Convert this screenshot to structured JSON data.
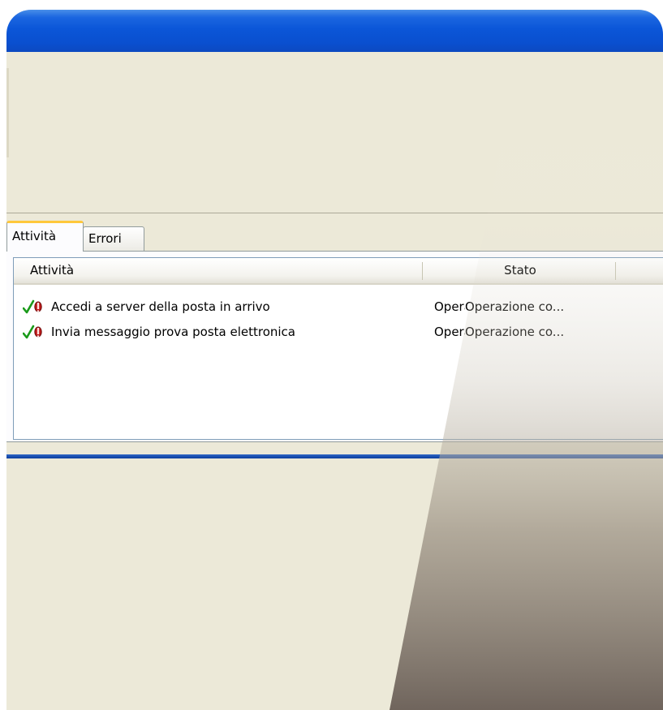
{
  "tabs": [
    {
      "label": "Attività",
      "active": true
    },
    {
      "label": "Errori",
      "active": false
    }
  ],
  "list": {
    "columns": [
      "Attività",
      "Stato"
    ],
    "rows": [
      {
        "name": "Accedi a server della posta in arrivo",
        "clipped": "Operazione completata",
        "status": "Operazione co..."
      },
      {
        "name": "Invia messaggio prova posta elettronica",
        "clipped": "Operazione completata",
        "status": "Operazione co..."
      }
    ]
  },
  "icons": {
    "row_icons": [
      "check-icon",
      "error-icon"
    ]
  },
  "colors": {
    "titlebar": "#0b56d8",
    "window": "#ece9d8",
    "tab_highlight": "#ffc83c",
    "check": "#1a9a1a",
    "error": "#c01818"
  }
}
